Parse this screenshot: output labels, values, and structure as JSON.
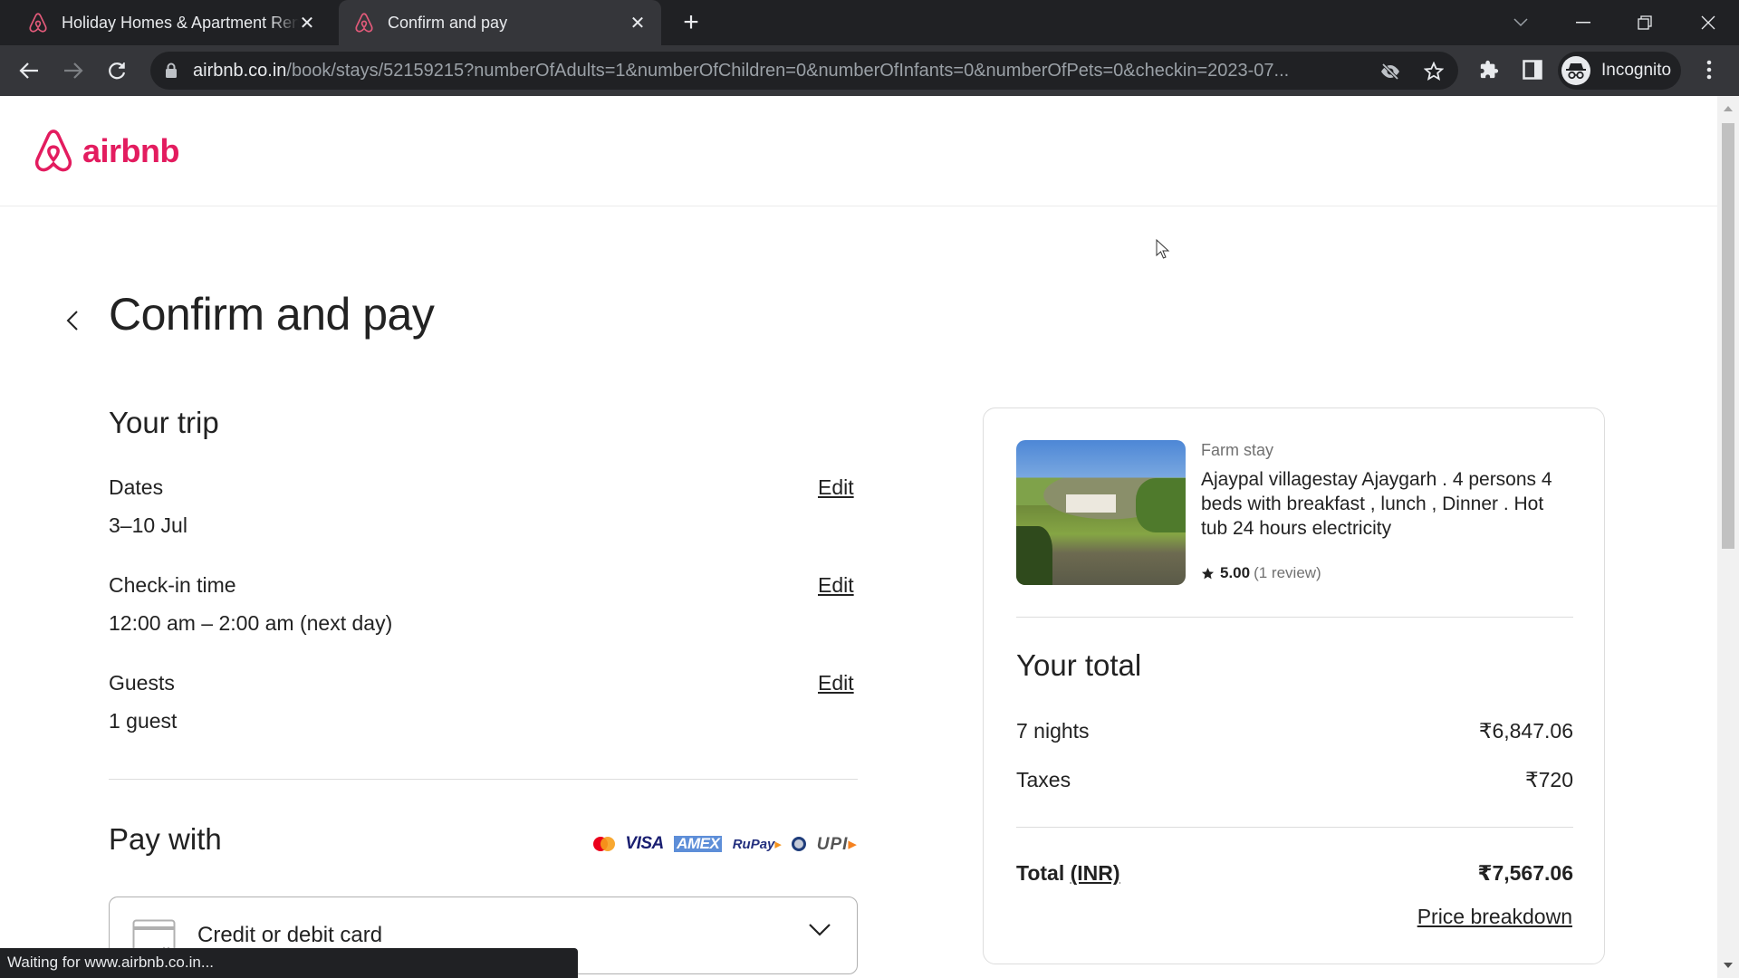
{
  "browser": {
    "tabs": [
      {
        "title": "Holiday Homes & Apartment Rentals - Airbnb",
        "favicon": "airbnb-icon",
        "active": false
      },
      {
        "title": "Confirm and pay",
        "favicon": "airbnb-icon",
        "active": true
      }
    ],
    "new_tab_label": "+",
    "url_host": "airbnb.co.in",
    "url_path": "/book/stays/52159215?numberOfAdults=1&numberOfChildren=0&numberOfInfants=0&numberOfPets=0&checkin=2023-07...",
    "profile_label": "Incognito",
    "status_text": "Waiting for www.airbnb.co.in..."
  },
  "header": {
    "logo_text": "airbnb",
    "brand_color": "#e31c5f"
  },
  "page": {
    "title": "Confirm and pay",
    "trip": {
      "heading": "Your trip",
      "rows": [
        {
          "label": "Dates",
          "value": "3–10 Jul",
          "action": "Edit"
        },
        {
          "label": "Check-in time",
          "value": "12:00 am – 2:00 am (next day)",
          "action": "Edit"
        },
        {
          "label": "Guests",
          "value": "1 guest",
          "action": "Edit"
        }
      ]
    },
    "pay": {
      "heading": "Pay with",
      "card_brands": [
        "Mastercard",
        "VISA",
        "AMEX",
        "RuPay",
        "Diners Club",
        "UPI"
      ],
      "method_selected": "Credit or debit card"
    }
  },
  "summary": {
    "listing_type": "Farm stay",
    "listing_title": "Ajaypal villagestay Ajaygarh . 4 persons 4 beds with breakfast , lunch , Dinner . Hot tub 24 hours electricity",
    "rating": "5.00",
    "reviews": "(1 review)",
    "total_heading": "Your total",
    "lines": [
      {
        "label": "7 nights",
        "amount": "₹6,847.06"
      },
      {
        "label": "Taxes",
        "amount": "₹720"
      }
    ],
    "total_label": "Total",
    "total_currency": "(INR)",
    "total_amount": "₹7,567.06",
    "breakdown_link": "Price breakdown"
  }
}
